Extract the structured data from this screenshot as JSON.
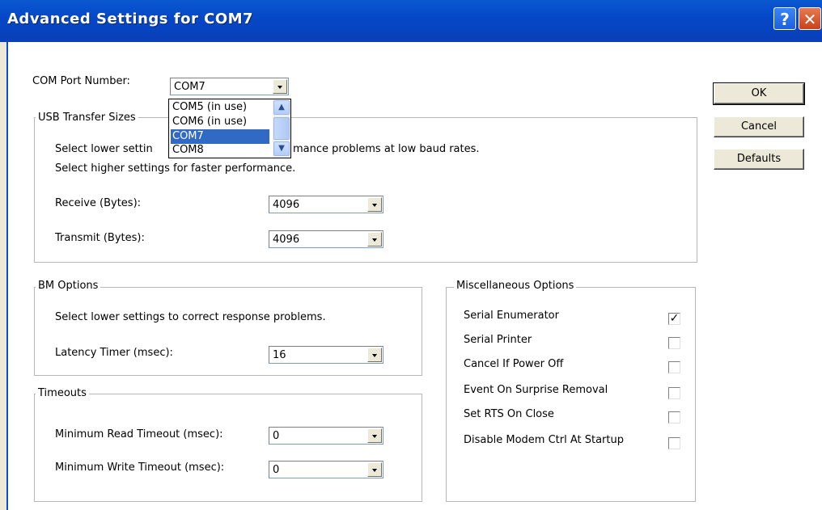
{
  "window": {
    "title": "Advanced Settings for COM7",
    "help_label": "?",
    "close_label": "✕"
  },
  "com_port": {
    "label": "COM Port Number:",
    "value": "COM7",
    "options": [
      "COM5 (in use)",
      "COM6 (in use)",
      "COM7",
      "COM8"
    ]
  },
  "buttons": {
    "ok": "OK",
    "cancel": "Cancel",
    "defaults": "Defaults"
  },
  "usb": {
    "title": "USB Transfer Sizes",
    "desc1_left": "Select lower settin",
    "desc1_right": "mance problems at low baud rates.",
    "desc2": "Select higher settings for faster performance.",
    "receive_label": "Receive (Bytes):",
    "receive_value": "4096",
    "transmit_label": "Transmit (Bytes):",
    "transmit_value": "4096"
  },
  "bm": {
    "title": "BM Options",
    "desc": "Select lower settings to correct response problems.",
    "latency_label": "Latency Timer (msec):",
    "latency_value": "16"
  },
  "timeouts": {
    "title": "Timeouts",
    "read_label": "Minimum Read Timeout (msec):",
    "read_value": "0",
    "write_label": "Minimum Write Timeout (msec):",
    "write_value": "0"
  },
  "misc": {
    "title": "Miscellaneous Options",
    "options": [
      {
        "label": "Serial Enumerator",
        "checked": true
      },
      {
        "label": "Serial Printer",
        "checked": false
      },
      {
        "label": "Cancel If Power Off",
        "checked": false
      },
      {
        "label": "Event On Surprise Removal",
        "checked": false
      },
      {
        "label": "Set RTS On Close",
        "checked": false
      },
      {
        "label": "Disable Modem Ctrl At Startup",
        "checked": false
      }
    ]
  },
  "colors": {
    "titlebar": "#0548c8",
    "selection": "#316ac5"
  }
}
